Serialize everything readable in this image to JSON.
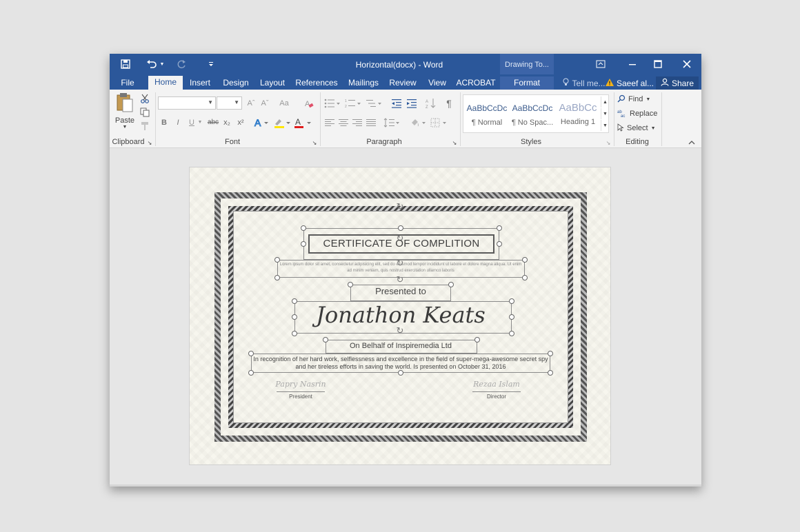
{
  "window": {
    "title": "Horizontal(docx) - Word",
    "context_group": "Drawing To...",
    "icons": [
      "save-icon",
      "undo-icon",
      "redo-icon",
      "customize-qat-icon",
      "ribbon-display-icon",
      "minimize-icon",
      "maximize-icon",
      "close-icon"
    ]
  },
  "tabs": [
    {
      "label": "File"
    },
    {
      "label": "Home"
    },
    {
      "label": "Insert"
    },
    {
      "label": "Design"
    },
    {
      "label": "Layout"
    },
    {
      "label": "References"
    },
    {
      "label": "Mailings"
    },
    {
      "label": "Review"
    },
    {
      "label": "View"
    },
    {
      "label": "ACROBAT"
    },
    {
      "label": "Format"
    }
  ],
  "tell_me": "Tell me...",
  "user": "Saeef al...",
  "share": "Share",
  "ribbon": {
    "clipboard": {
      "paste": "Paste",
      "label": "Clipboard"
    },
    "font": {
      "label": "Font",
      "bold": "B",
      "italic": "I",
      "underline": "U",
      "strike": "abc",
      "subscript": "x₂",
      "superscript": "x²",
      "grow": "Aˆ",
      "shrink": "Aˇ",
      "case": "Aa"
    },
    "paragraph": {
      "label": "Paragraph",
      "show_marks": "¶"
    },
    "styles": {
      "label": "Styles",
      "items": [
        {
          "sample": "AaBbCcDc",
          "name": "¶ Normal"
        },
        {
          "sample": "AaBbCcDc",
          "name": "¶ No Spac..."
        },
        {
          "sample": "AaBbCc",
          "name": "Heading 1"
        }
      ]
    },
    "editing": {
      "label": "Editing",
      "find": "Find",
      "replace": "Replace",
      "select": "Select"
    }
  },
  "certificate": {
    "title": "CERTIFICATE OF COMPLITION",
    "lorem": "Lorem ipsum dolor sit amet, consectetur adipisicing elit, sed do eiusmod tempor incididunt ut labore et dolore magna aliqua. Ut enim ad minim veniam, quis nostrud exercitation ullamco laboris",
    "presented_to": "Presented to",
    "name": "Jonathon Keats",
    "behalf": "On Belhalf of Inspiremedia Ltd",
    "recognition": "In recognition of her hard work, selflessness and excellence in the field of super-mega-awesome secret spy and her tireless efforts in saving the world. Is presented on October 31, 2016",
    "signatures": [
      {
        "sig": "Papry Nasrin",
        "role": "President"
      },
      {
        "sig": "Rezaa Islam",
        "role": "Director"
      }
    ]
  },
  "colors": {
    "accent": "#2b579a",
    "ribbon": "#f3f3f3",
    "page": "#f7f6ee"
  }
}
